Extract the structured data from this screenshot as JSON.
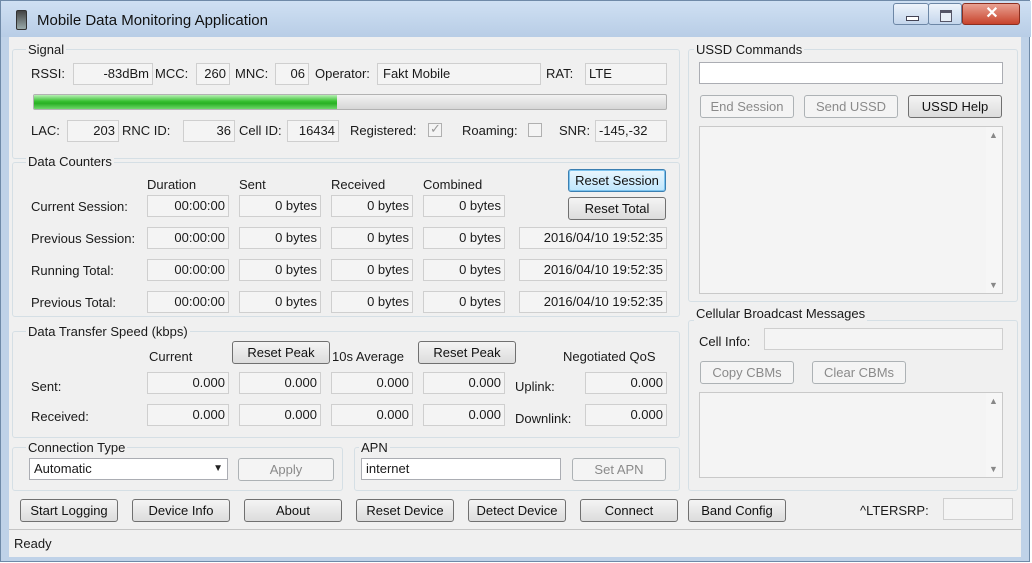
{
  "window": {
    "title": "Mobile Data Monitoring Application"
  },
  "signal": {
    "group_title": "Signal",
    "rssi_label": "RSSI:",
    "rssi": "-83dBm",
    "mcc_label": "MCC:",
    "mcc": "260",
    "mnc_label": "MNC:",
    "mnc": "06",
    "operator_label": "Operator:",
    "operator": "Fakt Mobile",
    "rat_label": "RAT:",
    "rat": "LTE",
    "signal_level": 0.48,
    "lac_label": "LAC:",
    "lac": "203",
    "rnc_label": "RNC ID:",
    "rnc": "36",
    "cell_label": "Cell ID:",
    "cell": "16434",
    "registered_label": "Registered:",
    "registered": true,
    "roaming_label": "Roaming:",
    "roaming": false,
    "snr_label": "SNR:",
    "snr": "-145,-32"
  },
  "counters": {
    "group_title": "Data Counters",
    "headers": [
      "Duration",
      "Sent",
      "Received",
      "Combined"
    ],
    "reset_session_label": "Reset Session",
    "reset_total_label": "Reset Total",
    "rows": [
      {
        "label": "Current Session:",
        "duration": "00:00:00",
        "sent": "0 bytes",
        "received": "0 bytes",
        "combined": "0 bytes",
        "timestamp": ""
      },
      {
        "label": "Previous Session:",
        "duration": "00:00:00",
        "sent": "0 bytes",
        "received": "0 bytes",
        "combined": "0 bytes",
        "timestamp": "2016/04/10 19:52:35"
      },
      {
        "label": "Running Total:",
        "duration": "00:00:00",
        "sent": "0 bytes",
        "received": "0 bytes",
        "combined": "0 bytes",
        "timestamp": "2016/04/10 19:52:35"
      },
      {
        "label": "Previous Total:",
        "duration": "00:00:00",
        "sent": "0 bytes",
        "received": "0 bytes",
        "combined": "0 bytes",
        "timestamp": "2016/04/10 19:52:35"
      }
    ]
  },
  "speed": {
    "group_title": "Data Transfer Speed (kbps)",
    "current_label": "Current",
    "reset_peak_label": "Reset Peak",
    "avg_label": "10s Average",
    "qos_label": "Negotiated QoS",
    "sent_label": "Sent:",
    "received_label": "Received:",
    "uplink_label": "Uplink:",
    "downlink_label": "Downlink:",
    "sent": [
      "0.000",
      "0.000",
      "0.000",
      "0.000"
    ],
    "received": [
      "0.000",
      "0.000",
      "0.000",
      "0.000"
    ],
    "uplink": "0.000",
    "downlink": "0.000"
  },
  "connection": {
    "group_title": "Connection Type",
    "value": "Automatic",
    "apply_label": "Apply"
  },
  "apn": {
    "group_title": "APN",
    "value": "internet",
    "set_label": "Set APN"
  },
  "ussd": {
    "group_title": "USSD Commands",
    "input": "",
    "end_label": "End Session",
    "send_label": "Send USSD",
    "help_label": "USSD Help"
  },
  "cbm": {
    "group_title": "Cellular Broadcast Messages",
    "cell_info_label": "Cell Info:",
    "cell_info": "",
    "copy_label": "Copy CBMs",
    "clear_label": "Clear CBMs"
  },
  "toolbar": {
    "start_logging": "Start Logging",
    "device_info": "Device Info",
    "about": "About",
    "reset_device": "Reset Device",
    "detect_device": "Detect Device",
    "connect": "Connect",
    "band_config": "Band Config",
    "lte_label": "^LTERSRP:",
    "lte_value": ""
  },
  "status": {
    "text": "Ready"
  },
  "icons": {
    "minimize": "minimize-icon",
    "maximize": "maximize-icon",
    "close": "close-icon",
    "app": "phone-icon",
    "dropdown": "chevron-down-icon",
    "check": "checkmark-icon"
  }
}
